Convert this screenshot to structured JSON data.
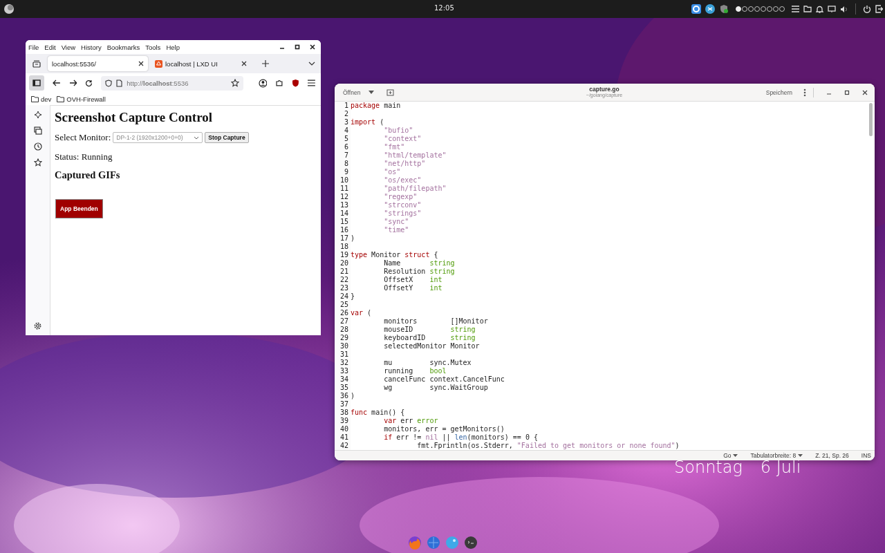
{
  "top_bar": {
    "clock": "12:05",
    "workspaces": [
      {
        "selected": true
      },
      {
        "selected": false
      },
      {
        "selected": false
      },
      {
        "selected": false
      },
      {
        "selected": false
      },
      {
        "selected": false
      },
      {
        "selected": false
      },
      {
        "selected": false
      }
    ]
  },
  "browser": {
    "menu": [
      "File",
      "Edit",
      "View",
      "History",
      "Bookmarks",
      "Tools",
      "Help"
    ],
    "tabs": [
      {
        "title": "localhost:5536/",
        "selected": true
      },
      {
        "title": "localhost | LXD UI",
        "selected": false
      }
    ],
    "url": "http://**localhost**:5536",
    "bookmarks": [
      "dev",
      "OVH-Firewall"
    ],
    "page": {
      "heading": "Screenshot Capture Control",
      "monitor_label": "Select Monitor:",
      "monitor_value": "DP-1-2 (1920x1200+0+0)",
      "stop_button": "Stop Capture",
      "status": "Status: Running",
      "gifs_heading": "Captured GIFs",
      "quit_button": "App Beenden"
    }
  },
  "editor": {
    "open_button": "Öffnen",
    "title": "capture.go",
    "path": "~/golang/capture",
    "save_button": "Speichern",
    "lines": [
      {
        "n": "1",
        "segs": [
          {
            "t": "package",
            "kind": "kw"
          },
          {
            "t": " main"
          }
        ]
      },
      {
        "n": "2"
      },
      {
        "n": "3",
        "segs": [
          {
            "t": "import",
            "kind": "kw"
          },
          {
            "t": " ("
          }
        ]
      },
      {
        "n": "4",
        "segs": [
          {
            "t": "\t\"bufio\"",
            "kind": "str"
          }
        ]
      },
      {
        "n": "5",
        "segs": [
          {
            "t": "\t\"context\"",
            "kind": "str"
          }
        ]
      },
      {
        "n": "6",
        "segs": [
          {
            "t": "\t\"fmt\"",
            "kind": "str"
          }
        ]
      },
      {
        "n": "7",
        "segs": [
          {
            "t": "\t\"html/template\"",
            "kind": "str"
          }
        ]
      },
      {
        "n": "8",
        "segs": [
          {
            "t": "\t\"net/http\"",
            "kind": "str"
          }
        ]
      },
      {
        "n": "9",
        "segs": [
          {
            "t": "\t\"os\"",
            "kind": "str"
          }
        ]
      },
      {
        "n": "10",
        "segs": [
          {
            "t": "\t\"os/exec\"",
            "kind": "str"
          }
        ]
      },
      {
        "n": "11",
        "segs": [
          {
            "t": "\t\"path/filepath\"",
            "kind": "str"
          }
        ]
      },
      {
        "n": "12",
        "segs": [
          {
            "t": "\t\"regexp\"",
            "kind": "str"
          }
        ]
      },
      {
        "n": "13",
        "segs": [
          {
            "t": "\t\"strconv\"",
            "kind": "str"
          }
        ]
      },
      {
        "n": "14",
        "segs": [
          {
            "t": "\t\"strings\"",
            "kind": "str"
          }
        ]
      },
      {
        "n": "15",
        "segs": [
          {
            "t": "\t\"sync\"",
            "kind": "str"
          }
        ]
      },
      {
        "n": "16",
        "segs": [
          {
            "t": "\t\"time\"",
            "kind": "str"
          }
        ]
      },
      {
        "n": "17",
        "segs": [
          {
            "t": ")"
          }
        ]
      },
      {
        "n": "18"
      },
      {
        "n": "19",
        "segs": [
          {
            "t": "type",
            "kind": "kw"
          },
          {
            "t": " Monitor "
          },
          {
            "t": "struct",
            "kind": "kw"
          },
          {
            "t": " {"
          }
        ]
      },
      {
        "n": "20",
        "segs": [
          {
            "t": "\tName       "
          },
          {
            "t": "string",
            "kind": "type"
          }
        ]
      },
      {
        "n": "21",
        "segs": [
          {
            "t": "\tResolution "
          },
          {
            "t": "string",
            "kind": "type"
          }
        ]
      },
      {
        "n": "22",
        "segs": [
          {
            "t": "\tOffsetX    "
          },
          {
            "t": "int",
            "kind": "type"
          }
        ]
      },
      {
        "n": "23",
        "segs": [
          {
            "t": "\tOffsetY    "
          },
          {
            "t": "int",
            "kind": "type"
          }
        ]
      },
      {
        "n": "24",
        "segs": [
          {
            "t": "}"
          }
        ]
      },
      {
        "n": "25"
      },
      {
        "n": "26",
        "segs": [
          {
            "t": "var",
            "kind": "kw"
          },
          {
            "t": " ("
          }
        ]
      },
      {
        "n": "27",
        "segs": [
          {
            "t": "\tmonitors        []Monitor"
          }
        ]
      },
      {
        "n": "28",
        "segs": [
          {
            "t": "\tmouseID         "
          },
          {
            "t": "string",
            "kind": "type"
          }
        ]
      },
      {
        "n": "29",
        "segs": [
          {
            "t": "\tkeyboardID      "
          },
          {
            "t": "string",
            "kind": "type"
          }
        ]
      },
      {
        "n": "30",
        "segs": [
          {
            "t": "\tselectedMonitor Monitor"
          }
        ]
      },
      {
        "n": "31"
      },
      {
        "n": "32",
        "segs": [
          {
            "t": "\tmu         sync.Mutex"
          }
        ]
      },
      {
        "n": "33",
        "segs": [
          {
            "t": "\trunning    "
          },
          {
            "t": "bool",
            "kind": "type"
          }
        ]
      },
      {
        "n": "34",
        "segs": [
          {
            "t": "\tcancelFunc context.CancelFunc"
          }
        ]
      },
      {
        "n": "35",
        "segs": [
          {
            "t": "\twg         sync.WaitGroup"
          }
        ]
      },
      {
        "n": "36",
        "segs": [
          {
            "t": ")"
          }
        ]
      },
      {
        "n": "37"
      },
      {
        "n": "38",
        "segs": [
          {
            "t": "func",
            "kind": "kw"
          },
          {
            "t": " main() {"
          }
        ]
      },
      {
        "n": "39",
        "segs": [
          {
            "t": "\tvar",
            "kind": "kw"
          },
          {
            "t": " err "
          },
          {
            "t": "error",
            "kind": "type"
          }
        ]
      },
      {
        "n": "40",
        "segs": [
          {
            "t": "\tmonitors, err = getMonitors()"
          }
        ]
      },
      {
        "n": "41",
        "segs": [
          {
            "t": "\tif",
            "kind": "kw"
          },
          {
            "t": " err != "
          },
          {
            "t": "nil",
            "kind": "const"
          },
          {
            "t": " || "
          },
          {
            "t": "len",
            "kind": "builtin"
          },
          {
            "t": "(monitors) == 0 {"
          }
        ]
      },
      {
        "n": "42",
        "segs": [
          {
            "t": "\t\tfmt.Fprintln(os.Stderr, "
          },
          {
            "t": "\"Failed to get monitors or none found\"",
            "kind": "str"
          },
          {
            "t": ")"
          }
        ]
      }
    ],
    "status": {
      "language": "Go",
      "tab_width": "Tabulatorbreite: 8",
      "position": "Z. 21, Sp. 26",
      "mode": "INS"
    }
  },
  "desktop": {
    "weekday": "Sonntag",
    "date": "6 Juli"
  }
}
